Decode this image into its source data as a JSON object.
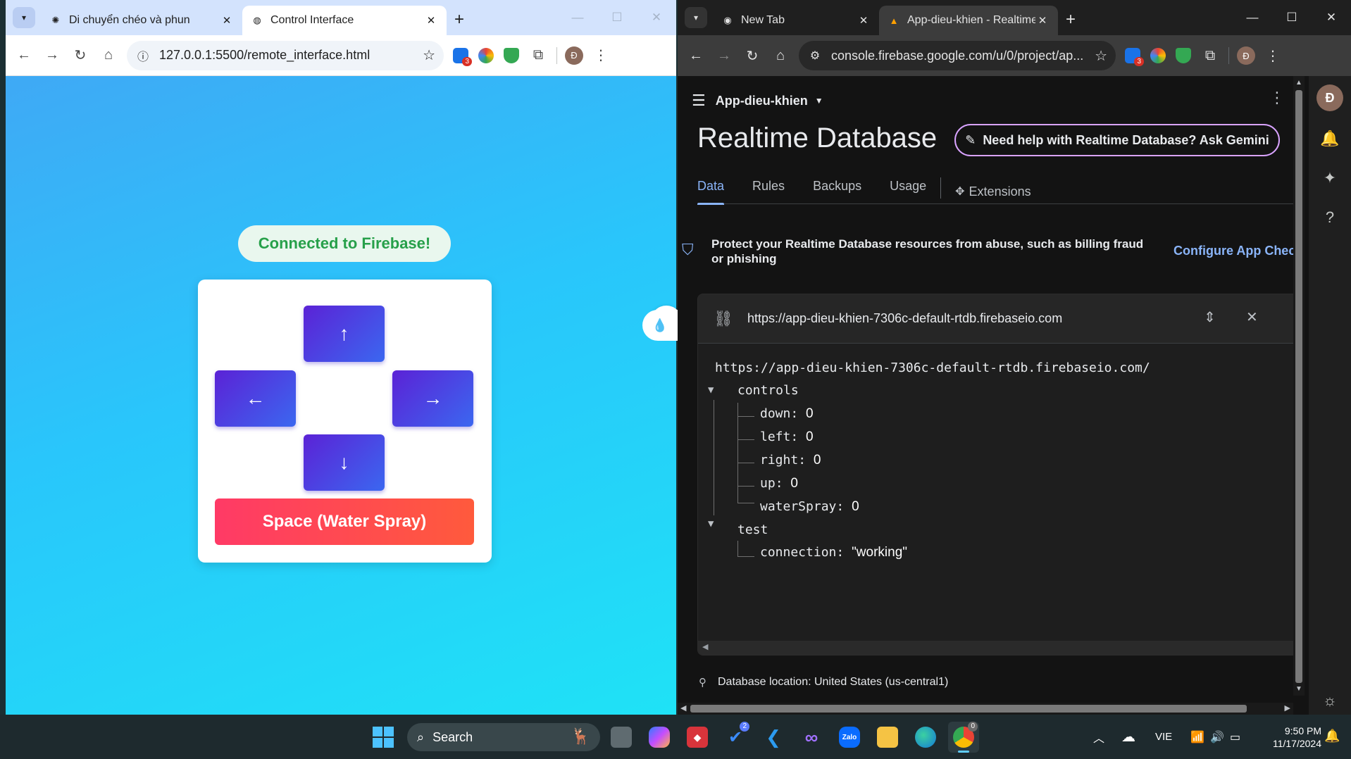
{
  "left_window": {
    "tabs": [
      {
        "title": "Di chuyển chéo và phun",
        "active": false
      },
      {
        "title": "Control Interface",
        "active": true
      }
    ],
    "url": "127.0.0.1:5500/remote_interface.html",
    "ext_badge": "3",
    "profile_initial": "Đ",
    "page": {
      "status": "Connected to Firebase!",
      "buttons": {
        "up": "↑",
        "left": "←",
        "right": "→",
        "down": "↓"
      },
      "spray_label": "Space (Water Spray)"
    }
  },
  "right_window": {
    "tabs": [
      {
        "title": "New Tab",
        "active": false
      },
      {
        "title": "App-dieu-khien - Realtime Data",
        "active": true
      }
    ],
    "url": "console.firebase.google.com/u/0/project/ap...",
    "ext_badge": "3",
    "profile_initial": "Đ",
    "console": {
      "project_name": "App-dieu-khien",
      "title": "Realtime Database",
      "gemini_button": "Need help with Realtime Database? Ask Gemini",
      "tabs": [
        "Data",
        "Rules",
        "Backups",
        "Usage",
        "Extensions"
      ],
      "active_tab": "Data",
      "banner_text": "Protect your Realtime Database resources from abuse, such as billing fraud or phishing",
      "banner_link": "Configure App Check",
      "db_url": "https://app-dieu-khien-7306c-default-rtdb.firebaseio.com",
      "tree_root": "https://app-dieu-khien-7306c-default-rtdb.firebaseio.com/",
      "controls_key": "controls",
      "controls": [
        {
          "key": "down",
          "value": "0"
        },
        {
          "key": "left",
          "value": "0"
        },
        {
          "key": "right",
          "value": "0"
        },
        {
          "key": "up",
          "value": "0"
        },
        {
          "key": "waterSpray",
          "value": "0"
        }
      ],
      "test_key": "test",
      "test": [
        {
          "key": "connection",
          "value": "\"working\""
        }
      ],
      "db_location": "Database location: United States (us-central1)",
      "rail_avatar": "Đ"
    }
  },
  "taskbar": {
    "search_label": "Search",
    "todo_badge": "2",
    "chrome_badge": "0",
    "language": "VIE",
    "time": "9:50 PM",
    "date": "11/17/2024"
  },
  "colors": {
    "accent_blue": "#8ab4f8",
    "gradient_button_start": "#5b22d6",
    "gradient_button_end": "#3b67f0",
    "spray_start": "#ff3a66",
    "spray_end": "#ff5a3c",
    "status_green": "#27a04a"
  }
}
